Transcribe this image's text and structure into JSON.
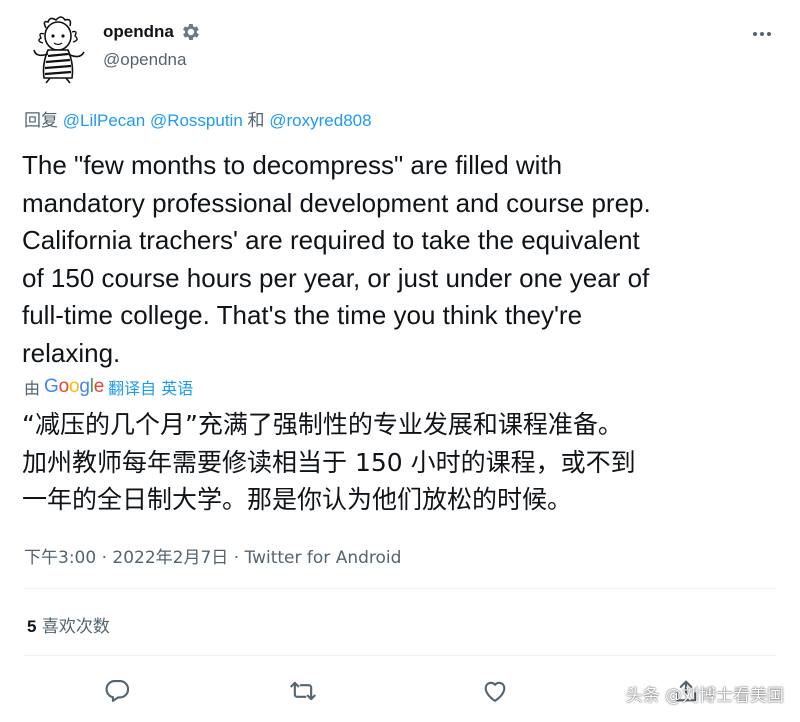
{
  "author": {
    "name": "opendna",
    "handle": "@opendna"
  },
  "reply": {
    "prefix": "回复",
    "mention1": "@LilPecan",
    "mention2": "@Rossputin",
    "conjunction": "和",
    "mention3": "@roxyred808"
  },
  "tweet": {
    "text": "The \"few months to decompress\" are filled with\nmandatory professional development and course prep.\nCalifornia trachers' are required to take the equivalent\nof 150 course hours per year, or just under one year of\nfull-time college. That's the time you think they're\nrelaxing."
  },
  "translation": {
    "by": "由",
    "google": [
      "G",
      "o",
      "o",
      "g",
      "l",
      "e"
    ],
    "link_text": "翻译自 英语",
    "text": "“减压的几个月”充满了强制性的专业发展和课程准备。\n加州教师每年需要修读相当于 150 小时的课程，或不到\n一年的全日制大学。那是你认为他们放松的时候。"
  },
  "meta": {
    "time": "下午3:00",
    "separator": "·",
    "date": "2022年2月7日",
    "client": "Twitter for Android"
  },
  "likes": {
    "count": "5",
    "label": "喜欢次数"
  },
  "watermark": "头条 @刘博士看美国",
  "icons": {
    "gear": "gear-icon",
    "more": "more-icon",
    "reply": "reply-icon",
    "retweet": "retweet-icon",
    "like": "heart-icon",
    "share": "share-icon"
  },
  "colors": {
    "link": "#1d9bf0",
    "secondary": "#536471",
    "text": "#0f1419"
  }
}
